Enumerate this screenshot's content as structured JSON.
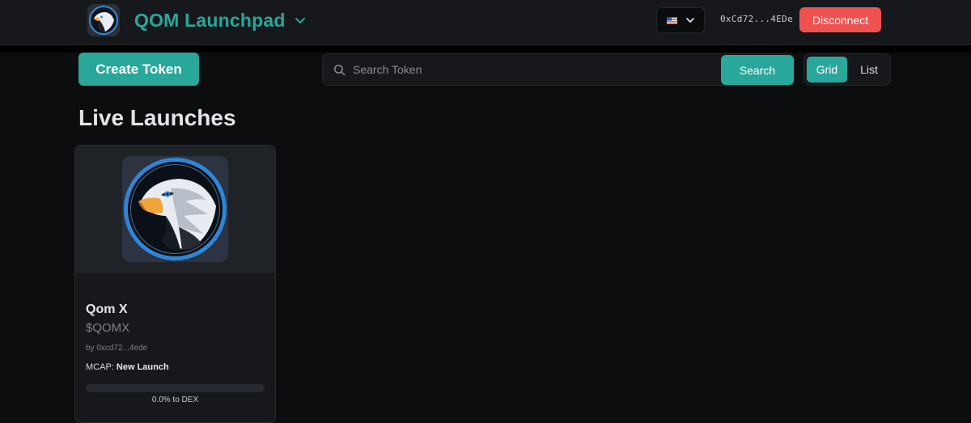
{
  "header": {
    "brand_title": "QOM Launchpad",
    "language_flag": "us-flag-icon",
    "wallet_address": "0xCd72...4EDe",
    "disconnect_label": "Disconnect"
  },
  "toolbar": {
    "create_label": "Create Token",
    "search_placeholder": "Search Token",
    "search_value": "",
    "search_button_label": "Search",
    "view_options": [
      "Grid",
      "List"
    ],
    "view_selected": "Grid"
  },
  "main": {
    "section_title": "Live Launches",
    "tokens": [
      {
        "name": "Qom X",
        "ticker": "$QOMX",
        "creator": "by 0xcd72...4ede",
        "mcap_label": "MCAP:",
        "mcap_value": "New Launch",
        "progress_fraction": 0.0,
        "progress_label": "0.0% to DEX",
        "image_icon": "eagle-logo-icon"
      }
    ]
  },
  "colors": {
    "accent": "#2aa79b",
    "danger": "#f05252",
    "background": "#0c0d0f",
    "surface": "#16181b"
  }
}
